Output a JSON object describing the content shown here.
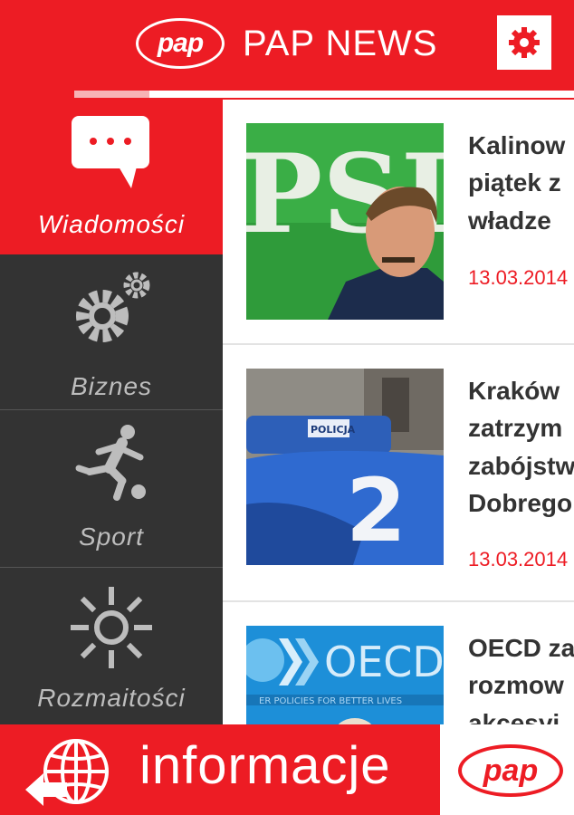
{
  "header": {
    "logo_text": "pap",
    "title": "PAP NEWS",
    "settings_icon": "gear-icon"
  },
  "progress": {
    "fraction": 0.15
  },
  "sidebar": {
    "items": [
      {
        "label": "Wiadomości",
        "icon": "speech-bubble-icon",
        "active": true
      },
      {
        "label": "Biznes",
        "icon": "gears-icon",
        "active": false
      },
      {
        "label": "Sport",
        "icon": "soccer-player-icon",
        "active": false
      },
      {
        "label": "Rozmaitości",
        "icon": "sun-icon",
        "active": false
      }
    ]
  },
  "articles": [
    {
      "lines": [
        "Kalinow",
        "piątek z",
        "władze"
      ],
      "date": "13.03.2014",
      "image": "PSL politician photo"
    },
    {
      "lines": [
        "Kraków",
        "zatrzym",
        "zabójstw",
        "Dobrego"
      ],
      "date": "13.03.2014",
      "image": "police car photo"
    },
    {
      "lines": [
        "OECD za",
        "rozmow",
        "akcesyi"
      ],
      "date": "",
      "image": "OECD logo photo"
    }
  ],
  "banner": {
    "text": "informacje",
    "logo_text": "pap",
    "globe_icon": "globe-arrow-icon"
  },
  "colors": {
    "brand_red": "#ed1c24",
    "sidebar_dark": "#333333"
  }
}
